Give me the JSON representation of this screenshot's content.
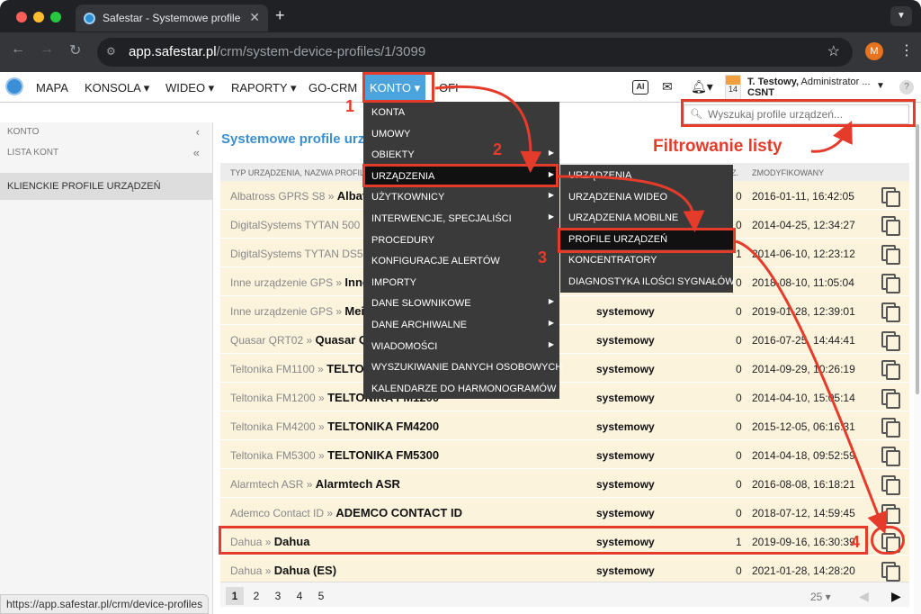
{
  "browser": {
    "tab_title": "Safestar - Systemowe profile",
    "url_host": "app.safestar.pl",
    "url_path": "/crm/system-device-profiles/1/3099",
    "profile_initial": "M",
    "status_url": "https://app.safestar.pl/crm/device-profiles"
  },
  "nav": {
    "items": [
      "MAPA",
      "KONSOLA ▾",
      "WIDEO ▾",
      "RAPORTY ▾",
      "GO-CRM",
      "KONTO ▾",
      "OFI"
    ],
    "calendar_day": "14",
    "user_name": "T. Testowy,",
    "user_role": "Administrator ...",
    "user_company": "CSNT"
  },
  "sidebar": {
    "konto": "KONTO",
    "lista_kont": "LISTA KONT",
    "active_item": "KLIENCKIE PROFILE URZĄDZEŃ"
  },
  "page": {
    "title": "Systemowe profile urządzeń",
    "search_placeholder": "Wyszukaj profile urządzeń...",
    "col_name": "TYP URZĄDZENIA, NAZWA PROFILU",
    "col_count": "Z.",
    "col_modified": "ZMODYFIKOWANY"
  },
  "rows": [
    {
      "type": "Albatross GPRS S8 »",
      "name": "Albatross GPRS S8",
      "kind": "systemowy",
      "count": "0",
      "modified": "2016-01-11, 16:42:05"
    },
    {
      "type": "DigitalSystems TYTAN 500 »",
      "name": "DigitalSystems TYTAN 500",
      "kind": "systemowy",
      "count": "0",
      "modified": "2014-04-25, 12:34:27"
    },
    {
      "type": "DigitalSystems TYTAN DS5xx »",
      "name": "DigitalSystems TYTAN DS5xx",
      "kind": "systemowy",
      "count": "1",
      "modified": "2014-06-10, 12:23:12"
    },
    {
      "type": "Inne urządzenie GPS »",
      "name": "Inne urządzenie GPS",
      "kind": "systemowy",
      "count": "0",
      "modified": "2018-08-10, 11:05:04"
    },
    {
      "type": "Inne urządzenie GPS »",
      "name": "Meitrack",
      "kind": "systemowy",
      "count": "0",
      "modified": "2019-01-28, 12:39:01"
    },
    {
      "type": "Quasar QRT02 »",
      "name": "Quasar QRT02",
      "kind": "systemowy",
      "count": "0",
      "modified": "2016-07-25, 14:44:41"
    },
    {
      "type": "Teltonika FM1100 »",
      "name": "TELTONIKA FM1100",
      "kind": "systemowy",
      "count": "0",
      "modified": "2014-09-29, 10:26:19"
    },
    {
      "type": "Teltonika FM1200 »",
      "name": "TELTONIKA FM1200",
      "kind": "systemowy",
      "count": "0",
      "modified": "2014-04-10, 15:05:14"
    },
    {
      "type": "Teltonika FM4200 »",
      "name": "TELTONIKA FM4200",
      "kind": "systemowy",
      "count": "0",
      "modified": "2015-12-05, 06:16:31"
    },
    {
      "type": "Teltonika FM5300 »",
      "name": "TELTONIKA FM5300",
      "kind": "systemowy",
      "count": "0",
      "modified": "2014-04-18, 09:52:59"
    },
    {
      "type": "Alarmtech ASR »",
      "name": "Alarmtech ASR",
      "kind": "systemowy",
      "count": "0",
      "modified": "2016-08-08, 16:18:21"
    },
    {
      "type": "Ademco Contact ID »",
      "name": "ADEMCO CONTACT ID",
      "kind": "systemowy",
      "count": "0",
      "modified": "2018-07-12, 14:59:45"
    },
    {
      "type": "Dahua »",
      "name": "Dahua",
      "kind": "systemowy",
      "count": "1",
      "modified": "2019-09-16, 16:30:39"
    },
    {
      "type": "Dahua »",
      "name": "Dahua (ES)",
      "kind": "systemowy",
      "count": "0",
      "modified": "2021-01-28, 14:28:20"
    }
  ],
  "pager": {
    "pages": [
      "1",
      "2",
      "3",
      "4",
      "5"
    ],
    "per_page": "25 ▾"
  },
  "konto_menu": [
    {
      "label": "KONTA",
      "sub": false
    },
    {
      "label": "UMOWY",
      "sub": false
    },
    {
      "label": "OBIEKTY",
      "sub": true
    },
    {
      "label": "URZĄDZENIA",
      "sub": true
    },
    {
      "label": "UŻYTKOWNICY",
      "sub": true
    },
    {
      "label": "INTERWENCJE, SPECJALIŚCI",
      "sub": true
    },
    {
      "label": "PROCEDURY",
      "sub": false
    },
    {
      "label": "KONFIGURACJE ALERTÓW",
      "sub": false
    },
    {
      "label": "IMPORTY",
      "sub": false
    },
    {
      "label": "DANE SŁOWNIKOWE",
      "sub": true
    },
    {
      "label": "DANE ARCHIWALNE",
      "sub": true
    },
    {
      "label": "WIADOMOŚCI",
      "sub": true
    },
    {
      "label": "WYSZUKIWANIE DANYCH OSOBOWYCH",
      "sub": false
    },
    {
      "label": "KALENDARZE DO HARMONOGRAMÓW",
      "sub": false
    }
  ],
  "urzadzenia_menu": [
    "URZĄDZENIA",
    "URZĄDZENIA WIDEO",
    "URZĄDZENIA MOBILNE",
    "PROFILE URZĄDZEŃ",
    "KONCENTRATORY",
    "DIAGNOSTYKA ILOŚCI SYGNAŁÓW"
  ],
  "annotations": {
    "step1": "1",
    "step2": "2",
    "step3": "3",
    "step4": "4",
    "filter_label": "Filtrowanie listy",
    "color": "#e53b2a"
  }
}
